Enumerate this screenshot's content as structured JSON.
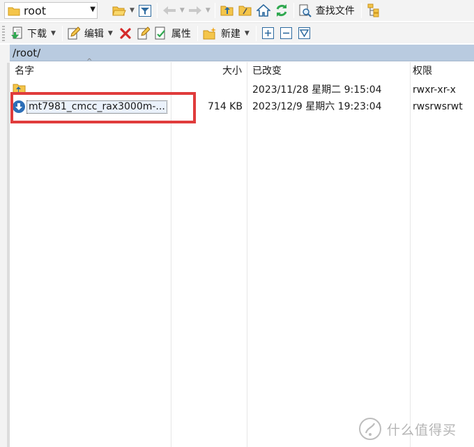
{
  "toolbar": {
    "location": "root",
    "download_label": "下载",
    "edit_label": "编辑",
    "properties_label": "属性",
    "new_label": "新建",
    "find_label": "查找文件"
  },
  "path": "/root/",
  "columns": {
    "name": "名字",
    "size": "大小",
    "modified": "已改变",
    "permissions": "权限"
  },
  "rows": [
    {
      "name": "",
      "size": "",
      "modified": "2023/11/28 星期二 9:15:04",
      "permissions": "rwxr-xr-x"
    },
    {
      "name": "mt7981_cmcc_rax3000m-...",
      "size": "714 KB",
      "modified": "2023/12/9 星期六 19:23:04",
      "permissions": "rwsrwsrwt"
    }
  ],
  "watermark": "什么值得买",
  "colors": {
    "path_bar": "#b9cbe0",
    "highlight": "#e03c3c",
    "folder": "#f4c54a",
    "selection": "#eaf1fb"
  }
}
